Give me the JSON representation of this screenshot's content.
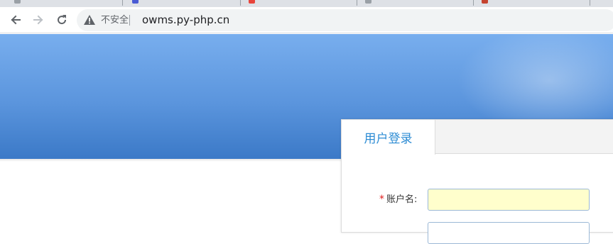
{
  "browser": {
    "security_label": "不安全",
    "url": "owms.py-php.cn",
    "favicon_colors": [
      "#9aa0a6",
      "#4a5bd4",
      "#e8453c",
      "#9aa0a6",
      "#c5432f"
    ]
  },
  "login": {
    "tab_label": "用户登录",
    "username_required_mark": "*",
    "username_label": "账户名:",
    "username_value": ""
  },
  "colors": {
    "banner_top": "#78aeee",
    "banner_bottom": "#3b79c7",
    "tab_text": "#2d8cd4",
    "autofill_bg": "#fffecc"
  }
}
